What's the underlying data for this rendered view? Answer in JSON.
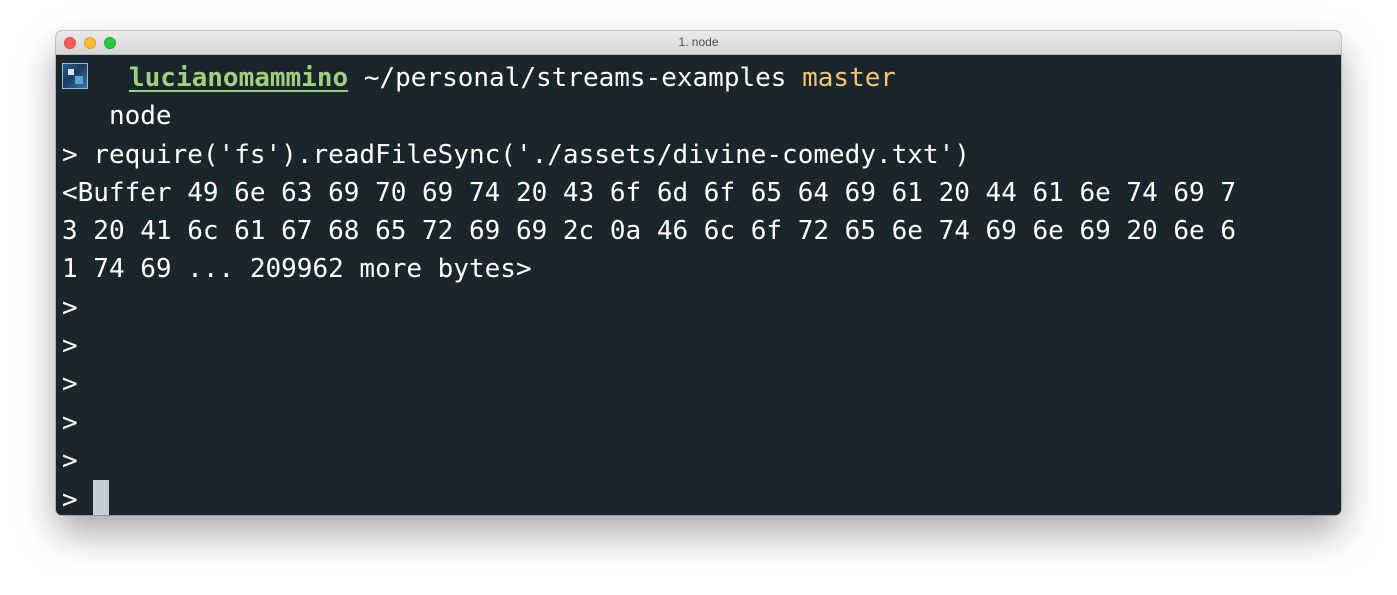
{
  "window": {
    "title": "1. node"
  },
  "prompt": {
    "user": "lucianomammino",
    "path": "~/personal/streams-examples",
    "branch": "master",
    "command": "node"
  },
  "repl": {
    "input_prefix": "> ",
    "input": "require('fs').readFileSync('./assets/divine-comedy.txt')",
    "output_lines": [
      "<Buffer 49 6e 63 69 70 69 74 20 43 6f 6d 6f 65 64 69 61 20 44 61 6e 74 69 7",
      "3 20 41 6c 61 67 68 65 72 69 69 2c 0a 46 6c 6f 72 65 6e 74 69 6e 69 20 6e 6",
      "1 74 69 ... 209962 more bytes>"
    ],
    "empty_prompt": ">",
    "active_prompt": "> "
  },
  "colors": {
    "background": "#1b262c",
    "user": "#9fd07e",
    "branch": "#f4c66f",
    "text": "#ffffff",
    "cursor": "#c5cdd6"
  }
}
